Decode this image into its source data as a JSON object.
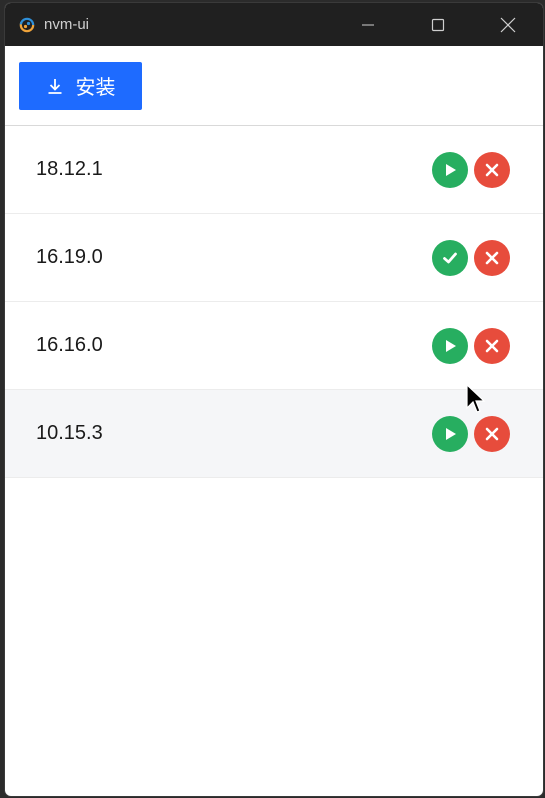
{
  "window": {
    "title": "nvm-ui"
  },
  "toolbar": {
    "install_label": "安装"
  },
  "colors": {
    "titlebar_bg": "#202020",
    "primary": "#1e6bff",
    "success": "#27ae60",
    "danger": "#e74c3c",
    "row_hover_bg": "#f5f6f8"
  },
  "versions": [
    {
      "version": "18.12.1",
      "status": "inactive",
      "primary_action_icon": "play-icon",
      "secondary_action_icon": "close-icon"
    },
    {
      "version": "16.19.0",
      "status": "active",
      "primary_action_icon": "check-icon",
      "secondary_action_icon": "close-icon"
    },
    {
      "version": "16.16.0",
      "status": "inactive",
      "primary_action_icon": "play-icon",
      "secondary_action_icon": "close-icon"
    },
    {
      "version": "10.15.3",
      "status": "inactive",
      "primary_action_icon": "play-icon",
      "secondary_action_icon": "close-icon"
    }
  ]
}
